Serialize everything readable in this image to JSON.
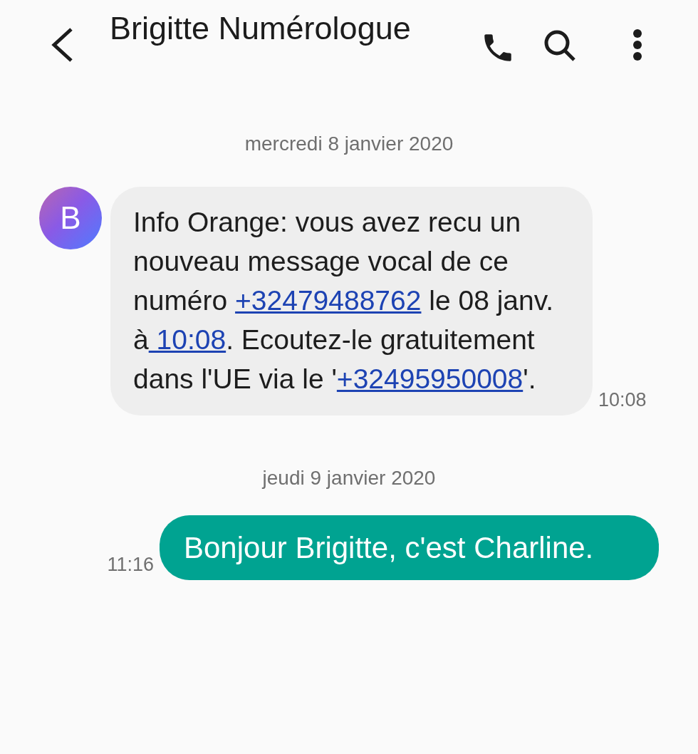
{
  "header": {
    "title": "Brigitte Numérologue"
  },
  "thread": [
    {
      "kind": "date",
      "text": "mercredi 8 janvier 2020"
    },
    {
      "kind": "incoming",
      "avatar": "B",
      "time": "10:08",
      "parts": [
        {
          "kind": "text",
          "text": "Info Orange: vous avez recu un nouveau message vocal de ce numéro "
        },
        {
          "kind": "link",
          "text": "+32479488762"
        },
        {
          "kind": "text",
          "text": " le 08 janv. à"
        },
        {
          "kind": "link",
          "text": " 10:08"
        },
        {
          "kind": "text",
          "text": ". Ecoutez-le gratuitement dans l'UE via le '"
        },
        {
          "kind": "link",
          "text": "+32495950008"
        },
        {
          "kind": "text",
          "text": "'."
        }
      ]
    },
    {
      "kind": "date",
      "text": "jeudi 9 janvier 2020"
    },
    {
      "kind": "outgoing",
      "time": "11:16",
      "text": "Bonjour Brigitte, c'est Charline."
    }
  ]
}
